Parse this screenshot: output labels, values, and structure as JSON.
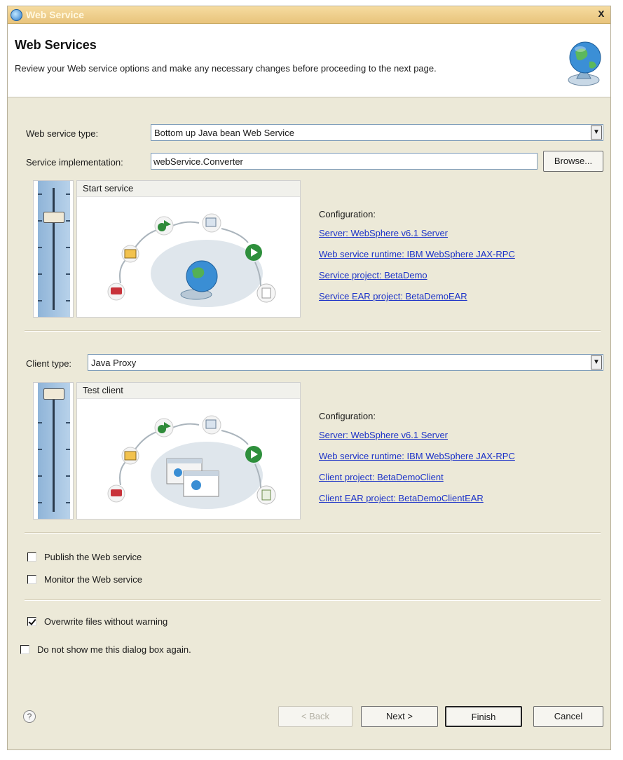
{
  "window": {
    "title": "Web Service",
    "close_label": "x"
  },
  "header": {
    "title": "Web Services",
    "description": "Review your Web service options and make any necessary changes before proceeding to the next page."
  },
  "service": {
    "type_label": "Web service type:",
    "type_value": "Bottom up Java bean Web Service",
    "impl_label": "Service implementation:",
    "impl_value": "webService.Converter",
    "browse_label": "Browse...",
    "panel_title": "Start service",
    "config_title": "Configuration:",
    "links": [
      "Server: WebSphere v6.1 Server",
      "Web service runtime: IBM WebSphere JAX-RPC",
      "Service project: BetaDemo",
      "Service EAR project: BetaDemoEAR"
    ],
    "slider_level": 0.22
  },
  "client": {
    "type_label": "Client type:",
    "type_value": "Java Proxy",
    "panel_title": "Test client",
    "config_title": "Configuration:",
    "links": [
      "Server: WebSphere v6.1 Server",
      "Web service runtime: IBM WebSphere JAX-RPC",
      "Client project: BetaDemoClient",
      "Client EAR project: BetaDemoClientEAR"
    ],
    "slider_level": 0.0
  },
  "options": {
    "publish_label": "Publish the Web service",
    "publish_checked": false,
    "monitor_label": "Monitor the Web service",
    "monitor_checked": false,
    "overwrite_label": "Overwrite files without warning",
    "overwrite_checked": true,
    "dont_show_label": "Do not show me this dialog box again.",
    "dont_show_checked": false
  },
  "footer": {
    "help_label": "?",
    "back_label": "< Back",
    "next_label": "Next >",
    "finish_label": "Finish",
    "cancel_label": "Cancel"
  }
}
